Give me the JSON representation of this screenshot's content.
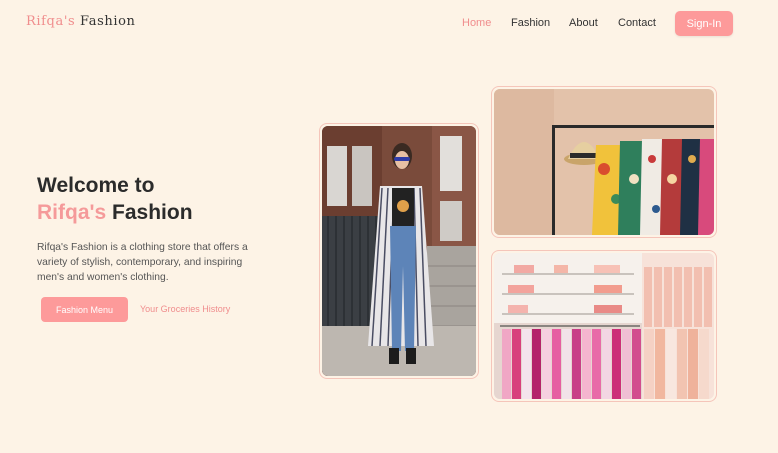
{
  "brand": {
    "name_first": "Rifqa's",
    "name_second": "Fashion"
  },
  "nav": {
    "items": [
      "Home",
      "Fashion",
      "About",
      "Contact"
    ],
    "active": "Home"
  },
  "header": {
    "signin_label": "Sign-In"
  },
  "hero": {
    "title_line1": "Welcome to",
    "title_accent": "Rifqa's",
    "title_rest": "Fashion",
    "description": "Rifqa's Fashion is a clothing store that offers a variety of stylish, contemporary, and inspiring men's and women's clothing.",
    "primary_button": "Fashion Menu",
    "secondary_link": "Your Groceries History"
  },
  "colors": {
    "accent": "#fd9a9a",
    "background": "#fdf3e6",
    "text": "#2b2b2b"
  },
  "images": [
    "woman-street-photo",
    "clothing-rack-photo",
    "store-display-photo"
  ]
}
